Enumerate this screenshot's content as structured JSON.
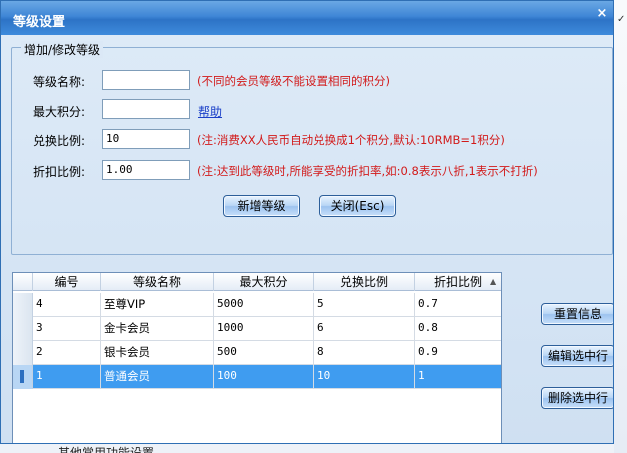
{
  "window": {
    "title": "等级设置",
    "close_glyph": "×"
  },
  "group": {
    "legend": "增加/修改等级"
  },
  "form": {
    "level_name": {
      "label": "等级名称:",
      "value": "",
      "note": "(不同的会员等级不能设置相同的积分)"
    },
    "max_points": {
      "label": "最大积分:",
      "value": "",
      "help": "帮助"
    },
    "exchange_ratio": {
      "label": "兑换比例:",
      "value": "10",
      "note": "(注:消费XX人民币自动兑换成1个积分,默认:10RMB=1积分)"
    },
    "discount_ratio": {
      "label": "折扣比例:",
      "value": "1.00",
      "note": "(注:达到此等级时,所能享受的折扣率,如:0.8表示八折,1表示不打折)"
    }
  },
  "buttons": {
    "add_level": "新增等级",
    "close": "关闭(Esc)",
    "reset": "重置信息",
    "edit_row": "编辑选中行",
    "delete_row": "删除选中行"
  },
  "grid": {
    "columns": [
      "编号",
      "等级名称",
      "最大积分",
      "兑换比例",
      "折扣比例"
    ],
    "rows": [
      {
        "id": "4",
        "name": "至尊VIP",
        "max": "5000",
        "ratio": "5",
        "discount": "0.7"
      },
      {
        "id": "3",
        "name": "金卡会员",
        "max": "1000",
        "ratio": "6",
        "discount": "0.8"
      },
      {
        "id": "2",
        "name": "银卡会员",
        "max": "500",
        "ratio": "8",
        "discount": "0.9"
      },
      {
        "id": "1",
        "name": "普通会员",
        "max": "100",
        "ratio": "10",
        "discount": "1"
      }
    ],
    "selected_row": 3
  },
  "background": {
    "bottom_text": "其他常用功能设置",
    "right_tick": "✓"
  },
  "colors": {
    "title_bar": "#3f86d6",
    "note_red": "#d21a1a",
    "selection": "#3f9cf0",
    "dialog_bg": "#cfe0f2"
  }
}
